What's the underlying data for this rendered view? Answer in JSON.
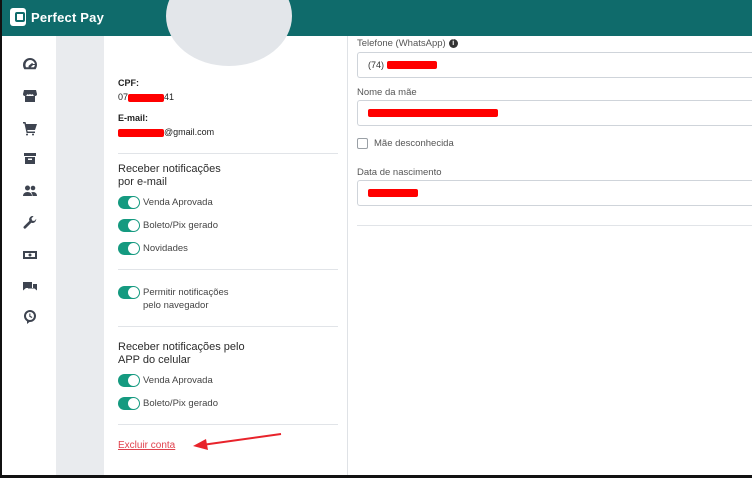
{
  "app": {
    "name": "Perfect Pay"
  },
  "sidebar": {
    "icons": [
      {
        "name": "dashboard-icon"
      },
      {
        "name": "store-icon"
      },
      {
        "name": "cart-icon"
      },
      {
        "name": "box-icon"
      },
      {
        "name": "users-icon"
      },
      {
        "name": "wrench-icon"
      },
      {
        "name": "money-icon"
      },
      {
        "name": "chat-icon"
      },
      {
        "name": "support-icon"
      }
    ]
  },
  "profile": {
    "cpf_label": "CPF:",
    "cpf_prefix": "07",
    "cpf_suffix": "41",
    "email_label": "E-mail:",
    "email_suffix": "@gmail.com"
  },
  "email_notifications": {
    "title": "Receber notificações por e-mail",
    "items": [
      {
        "label": "Venda Aprovada",
        "enabled": true
      },
      {
        "label": "Boleto/Pix gerado",
        "enabled": true
      },
      {
        "label": "Novidades",
        "enabled": true
      }
    ]
  },
  "browser_notifications": {
    "label": "Permitir notificações pelo navegador",
    "enabled": true
  },
  "app_notifications": {
    "title": "Receber notificações pelo APP do celular",
    "items": [
      {
        "label": "Venda Aprovada",
        "enabled": true
      },
      {
        "label": "Boleto/Pix gerado",
        "enabled": true
      }
    ]
  },
  "delete_account": {
    "label": "Excluir conta"
  },
  "form": {
    "phone_label": "Telefone (WhatsApp)",
    "phone_prefix": "(74)",
    "mother_label": "Nome da mãe",
    "mother_unknown_label": "Mãe desconhecida",
    "birth_label": "Data de nascimento"
  },
  "colors": {
    "brand": "#0f6b6b",
    "toggle_on": "#159a80",
    "link_danger": "#e0424d",
    "annotation": "#e8232b",
    "redaction": "#ff0000"
  }
}
